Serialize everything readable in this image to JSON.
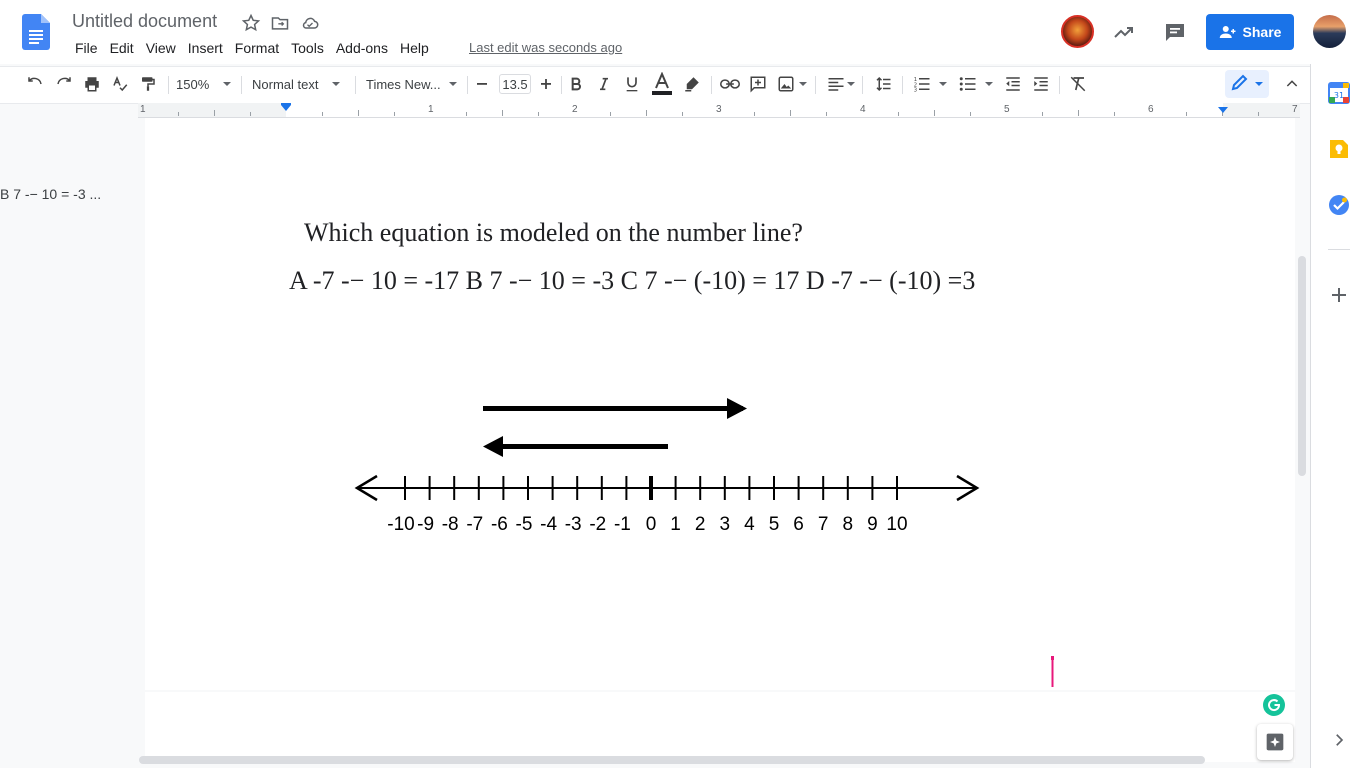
{
  "header": {
    "title": "Untitled document",
    "menu": [
      "File",
      "Edit",
      "View",
      "Insert",
      "Format",
      "Tools",
      "Add-ons",
      "Help"
    ],
    "last_edit": "Last edit was seconds ago",
    "share_label": "Share"
  },
  "toolbar": {
    "zoom": "150%",
    "style": "Normal text",
    "font": "Times New...",
    "font_size": "13.5"
  },
  "ruler": {
    "labels": [
      "1",
      "1",
      "2",
      "3",
      "4",
      "5",
      "6",
      "7"
    ]
  },
  "outline": {
    "text": "B 7 -− 10 = -3 ..."
  },
  "document": {
    "question": "Which equation is modeled on the number line?",
    "options": "A -7 -− 10 = -17   B 7 -− 10 = -3  C 7 -− (-10) = 17   D -7 -− (-10) =3",
    "number_line_labels": [
      "-10",
      "-9",
      "-8",
      "-7",
      "-6",
      "-5",
      "-4",
      "-3",
      "-2",
      "-1",
      "0",
      "1",
      "2",
      "3",
      "4",
      "5",
      "6",
      "7",
      "8",
      "9",
      "10"
    ]
  },
  "colors": {
    "accent": "#1a73e8",
    "grammarly": "#15c39a",
    "cursor": "#e8187b"
  },
  "icons": [
    "docs-logo-icon",
    "star-icon",
    "move-folder-icon",
    "cloud-status-icon",
    "trending-icon",
    "comment-icon",
    "undo-icon",
    "redo-icon",
    "print-icon",
    "spellcheck-icon",
    "paint-format-icon",
    "bold-icon",
    "italic-icon",
    "underline-icon",
    "text-color-icon",
    "highlight-icon",
    "link-icon",
    "add-comment-icon",
    "image-icon",
    "align-icon",
    "line-spacing-icon",
    "numbered-list-icon",
    "bulleted-list-icon",
    "decrease-indent-icon",
    "increase-indent-icon",
    "clear-formatting-icon",
    "pencil-icon",
    "collapse-icon",
    "calendar-icon",
    "keep-icon",
    "tasks-icon",
    "plus-icon",
    "explore-icon",
    "chevron-right-icon"
  ]
}
